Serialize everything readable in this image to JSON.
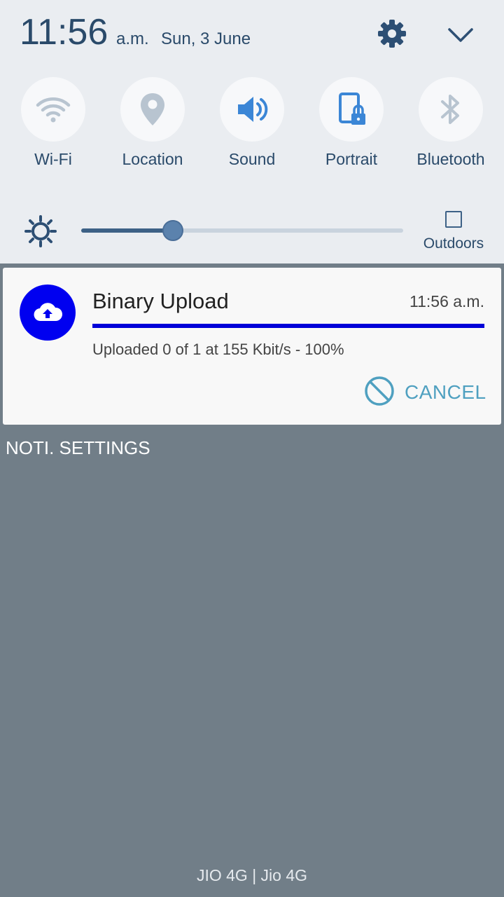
{
  "status": {
    "time": "11:56",
    "ampm": "a.m.",
    "date": "Sun, 3 June"
  },
  "icons": {
    "settings": "gear-icon",
    "collapse": "chevron-down-icon"
  },
  "quick_tiles": [
    {
      "label": "Wi-Fi",
      "icon": "wifi-icon"
    },
    {
      "label": "Location",
      "icon": "location-pin-icon"
    },
    {
      "label": "Sound",
      "icon": "speaker-icon"
    },
    {
      "label": "Portrait",
      "icon": "portrait-lock-icon"
    },
    {
      "label": "Bluetooth",
      "icon": "bluetooth-icon"
    }
  ],
  "brightness": {
    "level_fraction": 0.285,
    "outdoors_label": "Outdoors",
    "outdoors_checked": false
  },
  "notification": {
    "title": "Binary Upload",
    "time": "11:56 a.m.",
    "progress_fraction": 1.0,
    "text": "Uploaded 0 of 1 at 155 Kbit/s - 100%",
    "action_label": "CANCEL",
    "icon": "cloud-upload-icon",
    "icon_color": "#0000f0"
  },
  "noti_settings_label": "NOTI. SETTINGS",
  "carrier": "JIO 4G | Jio 4G",
  "colors": {
    "panel_bg": "#eaedf1",
    "text_primary": "#2a4a6a",
    "accent": "#4fa0c0",
    "backdrop": "#717e88"
  }
}
